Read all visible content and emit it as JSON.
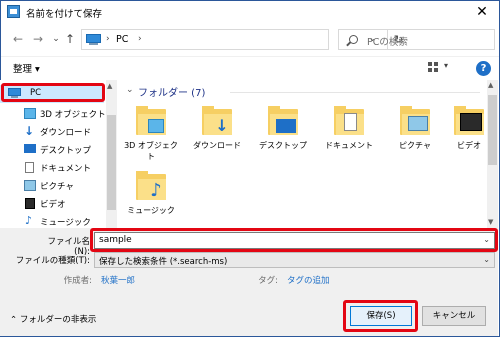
{
  "window": {
    "title": "名前を付けて保存",
    "close_glyph": "✕"
  },
  "nav": {
    "back_glyph": "←",
    "forward_glyph": "→",
    "recent_glyph": "⌄",
    "up_glyph": "↑",
    "address": "PC",
    "refresh_glyph": "↻",
    "search_placeholder": "PCの検索"
  },
  "toolbar": {
    "organize_label": "整理 ▾",
    "help_label": "?"
  },
  "sidebar": {
    "items": [
      {
        "label": "PC",
        "icon": "pc-icon"
      },
      {
        "label": "3D オブジェクト",
        "icon": "3d-objects-icon"
      },
      {
        "label": "ダウンロード",
        "icon": "download-icon"
      },
      {
        "label": "デスクトップ",
        "icon": "desktop-icon"
      },
      {
        "label": "ドキュメント",
        "icon": "document-icon"
      },
      {
        "label": "ピクチャ",
        "icon": "pictures-icon"
      },
      {
        "label": "ビデオ",
        "icon": "video-icon"
      },
      {
        "label": "ミュージック",
        "icon": "music-icon"
      }
    ]
  },
  "content": {
    "section_title": "フォルダー (7)",
    "folders": [
      {
        "label": "3D オブジェクト",
        "icon": "3d-objects-folder-icon"
      },
      {
        "label": "ダウンロード",
        "icon": "download-folder-icon"
      },
      {
        "label": "デスクトップ",
        "icon": "desktop-folder-icon"
      },
      {
        "label": "ドキュメント",
        "icon": "document-folder-icon"
      },
      {
        "label": "ピクチャ",
        "icon": "pictures-folder-icon"
      },
      {
        "label": "ビデオ",
        "icon": "video-folder-icon"
      },
      {
        "label": "ミュージック",
        "icon": "music-folder-icon"
      }
    ]
  },
  "form": {
    "filename_label": "ファイル名(N):",
    "filename_value": "sample",
    "filetype_label": "ファイルの種類(T):",
    "filetype_value": "保存した検索条件 (*.search-ms)",
    "author_label": "作成者:",
    "author_value": "秋葉一郎",
    "tag_label": "タグ:",
    "tag_value": "タグの追加"
  },
  "footer": {
    "hide_folders_label": "フォルダーの非表示",
    "save_label": "保存(S)",
    "cancel_label": "キャンセル"
  },
  "colors": {
    "highlight": "#e30613",
    "link": "#1e6fc7",
    "folder": "#f6cf63"
  }
}
